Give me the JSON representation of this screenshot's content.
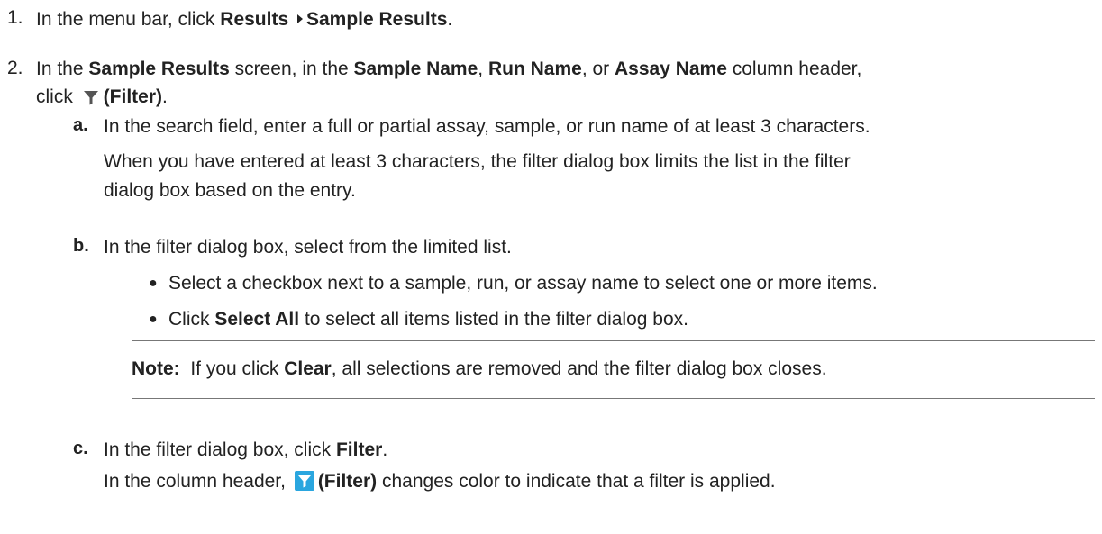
{
  "step1": {
    "number": "1.",
    "text_a": "In the menu bar, click ",
    "menu_results": "Results",
    "separator_icon": "right-triangle-icon",
    "menu_sample_results": "Sample Results",
    "period": "."
  },
  "step2": {
    "number": "2.",
    "text_a": "In the ",
    "screen_name": "Sample Results",
    "text_b": " screen, in the ",
    "col_sample": "Sample Name",
    "comma1": ", ",
    "col_run": "Run Name",
    "text_or": ", or ",
    "col_assay": "Assay Name",
    "text_c": " column header,",
    "text_click": "click ",
    "filter_label": "(Filter)",
    "period": "."
  },
  "substep_a": {
    "label": "a.",
    "line1": "In the search field, enter a full or partial assay, sample, or run name of at least 3 characters.",
    "line2": "When you have entered at least 3 characters, the filter dialog box limits the list in the filter",
    "line3": "dialog box based on the entry."
  },
  "substep_b": {
    "label": "b.",
    "line1": "In the filter dialog box, select from the limited list.",
    "bullet1": "Select a checkbox next to a sample, run, or assay name to select one or more items.",
    "bullet2_a": "Click ",
    "bullet2_kw": "Select All",
    "bullet2_b": " to select all items listed in the filter dialog box."
  },
  "note": {
    "label": "Note:",
    "text_a": "  If you click ",
    "keyword": "Clear",
    "text_b": ", all selections are removed and the filter dialog box closes."
  },
  "substep_c": {
    "label": "c.",
    "line1_a": "In the filter dialog box, click ",
    "line1_kw": "Filter",
    "line1_b": ".",
    "line2_a": "In the column header, ",
    "filter_label": "(Filter)",
    "line2_b": " changes color to indicate that a filter is applied."
  },
  "colors": {
    "text": "#222222",
    "filter_icon_plain": "#555555",
    "filter_icon_active_bg": "#2aa6df",
    "rule": "#777777"
  }
}
